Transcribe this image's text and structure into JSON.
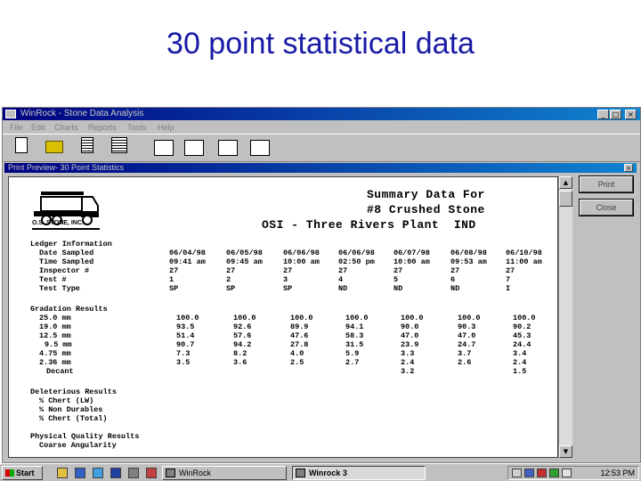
{
  "slide": {
    "title": "30 point statistical data"
  },
  "window": {
    "title": "WinRock - Stone Data Analysis",
    "menu": [
      "File",
      "Edit",
      "Charts",
      "Reports",
      "Tools",
      "Help"
    ],
    "controls": {
      "minimize": "_",
      "maximize": "□",
      "close": "×"
    }
  },
  "preview": {
    "title": "Print Preview- 30 Point Statistics",
    "close": "×",
    "buttons": {
      "print": "Print",
      "close": "Close"
    }
  },
  "report": {
    "logo_text": "O.S. STONE, INC.",
    "title_line1": "Summary Data For",
    "title_line2": "#8 Crushed Stone",
    "title_line3": "OSI - Three Rivers Plant  IND",
    "ledger_header": "Ledger Information",
    "ledger_labels": [
      "Date Sampled",
      "Time Sampled",
      "Inspector #",
      "Test #",
      "Test Type"
    ],
    "columns": [
      {
        "date": "06/04/98",
        "time": "09:41 am",
        "inspector": "27",
        "test": "1",
        "type": "SP",
        "grad": [
          "100.0",
          "93.5",
          "51.4",
          "90.7",
          "7.3",
          "3.5",
          ""
        ]
      },
      {
        "date": "06/05/98",
        "time": "09:45 am",
        "inspector": "27",
        "test": "2",
        "type": "SP",
        "grad": [
          "100.0",
          "92.6",
          "57.6",
          "94.2",
          "8.2",
          "3.6",
          ""
        ]
      },
      {
        "date": "06/06/98",
        "time": "10:00 am",
        "inspector": "27",
        "test": "3",
        "type": "SP",
        "grad": [
          "100.0",
          "89.9",
          "47.6",
          "27.8",
          "4.0",
          "2.5",
          ""
        ]
      },
      {
        "date": "06/06/98",
        "time": "02:50 pm",
        "inspector": "27",
        "test": "4",
        "type": "ND",
        "grad": [
          "100.0",
          "94.1",
          "58.3",
          "31.5",
          "5.9",
          "2.7",
          ""
        ]
      },
      {
        "date": "06/07/98",
        "time": "10:00 am",
        "inspector": "27",
        "test": "5",
        "type": "ND",
        "grad": [
          "100.0",
          "90.0",
          "47.0",
          "23.9",
          "3.3",
          "2.4",
          "3.2"
        ]
      },
      {
        "date": "06/08/98",
        "time": "09:53 am",
        "inspector": "27",
        "test": "6",
        "type": "ND",
        "grad": [
          "100.0",
          "90.3",
          "47.0",
          "24.7",
          "3.7",
          "2.6",
          ""
        ]
      },
      {
        "date": "06/10/98",
        "time": "11:00 am",
        "inspector": "27",
        "test": "7",
        "type": "I",
        "grad": [
          "100.0",
          "90.2",
          "45.3",
          "24.4",
          "3.4",
          "2.4",
          "1.5"
        ]
      }
    ],
    "gradation_header": "Gradation Results",
    "gradation_labels": [
      "25.0 mm",
      "19.0 mm",
      "12.5 mm",
      "9.5 mm",
      "4.75 mm",
      "2.36 mm",
      "Decant"
    ],
    "deleterious_header": "Deleterious Results",
    "deleterious_labels": [
      "% Chert (LW)",
      "% Non Durables",
      "% Chert (Total)"
    ],
    "physical_header": "Physical Quality Results",
    "physical_labels": [
      "Coarse Angularity"
    ]
  },
  "taskbar": {
    "start_label": "Start",
    "tasks": [
      {
        "label": "WinRock",
        "active": false
      },
      {
        "label": "Winrock 3",
        "active": true
      }
    ],
    "clock": "12:53 PM"
  },
  "colors": {
    "title_text": "#1a1aa6",
    "titlebar": "#000080",
    "chrome": "#c0c0c0"
  }
}
